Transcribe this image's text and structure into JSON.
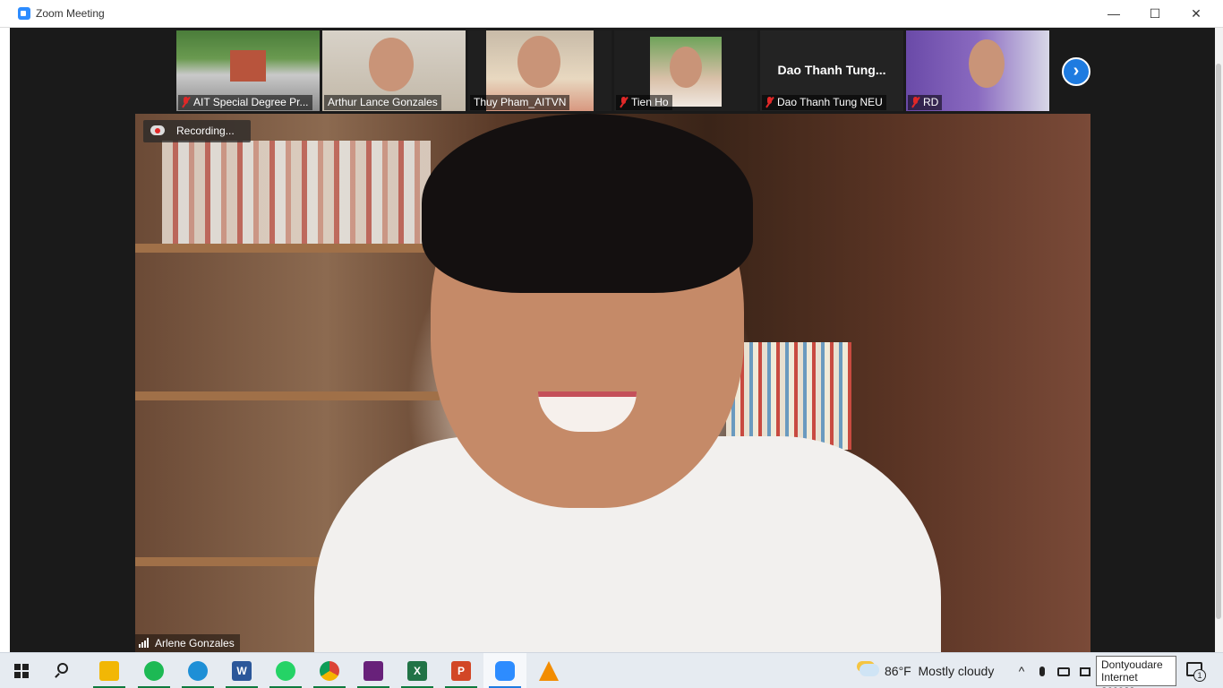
{
  "window": {
    "title": "Zoom Meeting",
    "minimize": "—",
    "maximize": "☐",
    "close": "✕"
  },
  "thumbnails": [
    {
      "name": "AIT Special Degree Pr...",
      "muted": true
    },
    {
      "name": "Arthur Lance Gonzales",
      "muted": false
    },
    {
      "name": "Thuy Pham_AITVN",
      "muted": false
    },
    {
      "name": "Tien Ho",
      "muted": true
    },
    {
      "name": "Dao Thanh Tung NEU",
      "muted": true,
      "display_name": "Dao Thanh Tung..."
    },
    {
      "name": "RD",
      "muted": true
    }
  ],
  "next_page": "›",
  "recording": {
    "label": "Recording..."
  },
  "active_speaker": {
    "name": "Arlene Gonzales"
  },
  "taskbar": {
    "apps": [
      {
        "icon": "start-icon"
      },
      {
        "icon": "search-icon"
      },
      {
        "icon": "file-explorer-icon",
        "color": "#f2b705"
      },
      {
        "icon": "spotify-icon",
        "color": "#1db954"
      },
      {
        "icon": "edge-icon",
        "color": "#1e8fd6"
      },
      {
        "icon": "word-icon",
        "color": "#2b579a",
        "glyph": "W"
      },
      {
        "icon": "whatsapp-icon",
        "color": "#25d366"
      },
      {
        "icon": "chrome-icon",
        "color": "#db4437"
      },
      {
        "icon": "visual-studio-icon",
        "color": "#68217a"
      },
      {
        "icon": "excel-icon",
        "color": "#217346",
        "glyph": "X"
      },
      {
        "icon": "powerpoint-icon",
        "color": "#d24726",
        "glyph": "P"
      },
      {
        "icon": "zoom-icon",
        "color": "#2d8cff"
      },
      {
        "icon": "vlc-icon",
        "color": "#f28c00"
      }
    ],
    "weather": {
      "temp": "86°F",
      "condition": "Mostly cloudy"
    },
    "tray": {
      "chevron": "^"
    },
    "tooltip": {
      "line1": "Dontyoudare",
      "line2": "Internet access"
    },
    "notifications": {
      "count": "1"
    }
  }
}
